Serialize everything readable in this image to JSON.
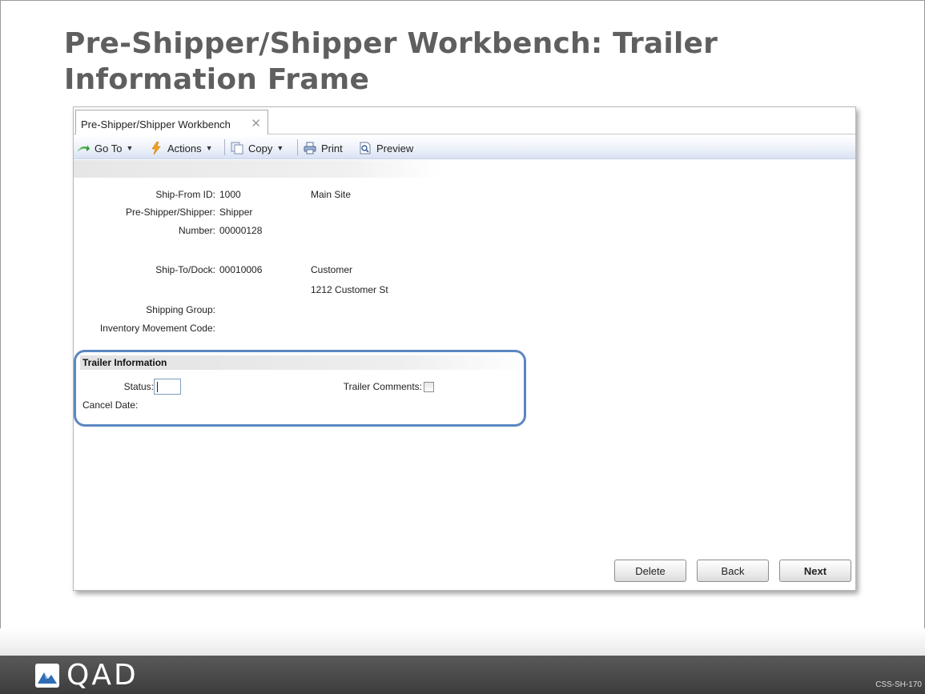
{
  "slide": {
    "title": "Pre-Shipper/Shipper Workbench: Trailer Information Frame",
    "slide_code": "CSS-SH-170",
    "logo_text": "QAD"
  },
  "window": {
    "tab_label": "Pre-Shipper/Shipper Workbench",
    "tab_close_glyph": "✕"
  },
  "toolbar": {
    "goto": "Go To",
    "actions": "Actions",
    "copy": "Copy",
    "print": "Print",
    "preview": "Preview",
    "dropdown_glyph": "▼"
  },
  "header_fields": {
    "ship_from_label": "Ship-From ID:",
    "ship_from_value": "1000",
    "ship_from_desc": "Main Site",
    "pre_shipper_label": "Pre-Shipper/Shipper:",
    "pre_shipper_value": "Shipper",
    "number_label": "Number:",
    "number_value": "00000128",
    "ship_to_label": "Ship-To/Dock:",
    "ship_to_value": "00010006",
    "ship_to_name": "Customer",
    "ship_to_address": "1212 Customer St",
    "shipping_group_label": "Shipping Group:",
    "inventory_movement_label": "Inventory Movement Code:"
  },
  "trailer_section": {
    "title": "Trailer Information",
    "status_label": "Status:",
    "status_value": "",
    "trailer_comments_label": "Trailer Comments:",
    "trailer_comments_checked": false,
    "cancel_date_label": "Cancel Date:"
  },
  "buttons": {
    "delete": "Delete",
    "back": "Back",
    "next": "Next"
  },
  "colors": {
    "highlight": "#5b87c2",
    "title_text": "#5f5f5f",
    "footer": "#4a4a4a"
  }
}
